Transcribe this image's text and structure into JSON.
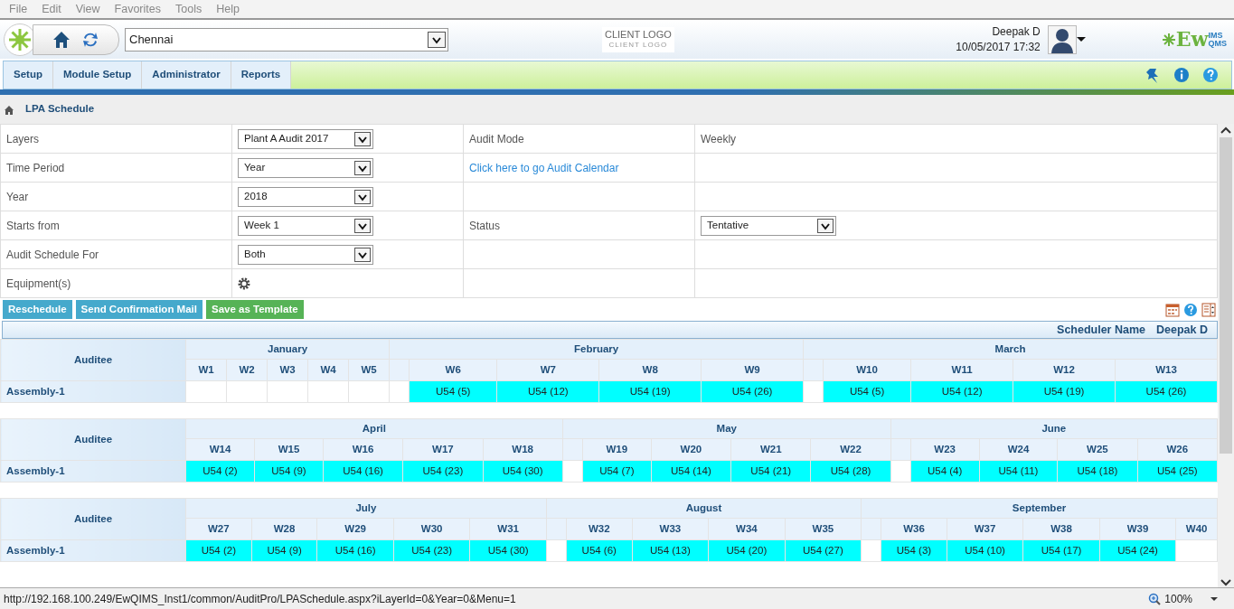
{
  "browser_menu": [
    "File",
    "Edit",
    "View",
    "Favorites",
    "Tools",
    "Help"
  ],
  "header": {
    "location": "Chennai",
    "client_logo": "CLIENT LOGO",
    "client_logo_tagline": "CLIENT LOGO",
    "user": "Deepak D",
    "datetime": "10/05/2017 17:32",
    "brand": {
      "main": "Ew",
      "sup": "IMS",
      "sub": "QMS"
    }
  },
  "nav": [
    "Setup",
    "Module Setup",
    "Administrator",
    "Reports"
  ],
  "breadcrumb": "LPA Schedule",
  "form": [
    {
      "cells": [
        {
          "kind": "label",
          "text": "Layers"
        },
        {
          "kind": "select",
          "value": "Plant A Audit 2017"
        },
        {
          "kind": "label",
          "text": "Audit Mode"
        },
        {
          "kind": "label",
          "text": "Weekly"
        }
      ]
    },
    {
      "cells": [
        {
          "kind": "label",
          "text": "Time Period"
        },
        {
          "kind": "select",
          "value": "Year"
        },
        {
          "kind": "link",
          "text": "Click here to go Audit Calendar"
        },
        {
          "kind": "empty"
        }
      ]
    },
    {
      "cells": [
        {
          "kind": "label",
          "text": "Year"
        },
        {
          "kind": "select",
          "value": "2018"
        },
        {
          "kind": "empty"
        },
        {
          "kind": "empty"
        }
      ]
    },
    {
      "cells": [
        {
          "kind": "label",
          "text": "Starts from"
        },
        {
          "kind": "select",
          "value": "Week 1"
        },
        {
          "kind": "label",
          "text": "Status"
        },
        {
          "kind": "select",
          "value": "Tentative"
        }
      ]
    },
    {
      "cells": [
        {
          "kind": "label",
          "text": "Audit Schedule For"
        },
        {
          "kind": "select",
          "value": "Both"
        },
        {
          "kind": "empty"
        },
        {
          "kind": "empty"
        }
      ]
    },
    {
      "cells": [
        {
          "kind": "label",
          "text": "Equipment(s)"
        },
        {
          "kind": "gear"
        },
        {
          "kind": "empty"
        },
        {
          "kind": "empty"
        }
      ]
    }
  ],
  "actions": [
    {
      "label": "Reschedule",
      "color": "#45a9cc"
    },
    {
      "label": "Send Confirmation Mail",
      "color": "#45a9cc"
    },
    {
      "label": "Save as Template",
      "color": "#56b356"
    }
  ],
  "scheduler": {
    "label": "Scheduler Name",
    "name": "Deepak D"
  },
  "schedule_blocks": [
    {
      "header": "Auditee",
      "auditee": "Assembly-1",
      "months": [
        {
          "name": "January",
          "weeks": [
            {
              "label": "W1"
            },
            {
              "label": "W2"
            },
            {
              "label": "W3"
            },
            {
              "label": "W4"
            },
            {
              "label": "W5"
            }
          ]
        },
        {
          "name": "February",
          "weeks": [
            {
              "label": "W6",
              "entry": "U54 (5)"
            },
            {
              "label": "W7",
              "entry": "U54 (12)"
            },
            {
              "label": "W8",
              "entry": "U54 (19)"
            },
            {
              "label": "W9",
              "entry": "U54 (26)"
            }
          ]
        },
        {
          "name": "March",
          "weeks": [
            {
              "label": "W10",
              "entry": "U54 (5)"
            },
            {
              "label": "W11",
              "entry": "U54 (12)"
            },
            {
              "label": "W12",
              "entry": "U54 (19)"
            },
            {
              "label": "W13",
              "entry": "U54 (26)"
            }
          ]
        }
      ]
    },
    {
      "header": "Auditee",
      "auditee": "Assembly-1",
      "months": [
        {
          "name": "April",
          "weeks": [
            {
              "label": "W14",
              "entry": "U54 (2)"
            },
            {
              "label": "W15",
              "entry": "U54 (9)"
            },
            {
              "label": "W16",
              "entry": "U54 (16)"
            },
            {
              "label": "W17",
              "entry": "U54 (23)"
            },
            {
              "label": "W18",
              "entry": "U54 (30)"
            }
          ]
        },
        {
          "name": "May",
          "weeks": [
            {
              "label": "W19",
              "entry": "U54 (7)"
            },
            {
              "label": "W20",
              "entry": "U54 (14)"
            },
            {
              "label": "W21",
              "entry": "U54 (21)"
            },
            {
              "label": "W22",
              "entry": "U54 (28)"
            }
          ]
        },
        {
          "name": "June",
          "weeks": [
            {
              "label": "W23",
              "entry": "U54 (4)"
            },
            {
              "label": "W24",
              "entry": "U54 (11)"
            },
            {
              "label": "W25",
              "entry": "U54 (18)"
            },
            {
              "label": "W26",
              "entry": "U54 (25)"
            }
          ]
        }
      ]
    },
    {
      "header": "Auditee",
      "auditee": "Assembly-1",
      "months": [
        {
          "name": "July",
          "weeks": [
            {
              "label": "W27",
              "entry": "U54 (2)"
            },
            {
              "label": "W28",
              "entry": "U54 (9)"
            },
            {
              "label": "W29",
              "entry": "U54 (16)"
            },
            {
              "label": "W30",
              "entry": "U54 (23)"
            },
            {
              "label": "W31",
              "entry": "U54 (30)"
            }
          ]
        },
        {
          "name": "August",
          "weeks": [
            {
              "label": "W32",
              "entry": "U54 (6)"
            },
            {
              "label": "W33",
              "entry": "U54 (13)"
            },
            {
              "label": "W34",
              "entry": "U54 (20)"
            },
            {
              "label": "W35",
              "entry": "U54 (27)"
            }
          ]
        },
        {
          "name": "September",
          "weeks": [
            {
              "label": "W36",
              "entry": "U54 (3)"
            },
            {
              "label": "W37",
              "entry": "U54 (10)"
            },
            {
              "label": "W38",
              "entry": "U54 (17)"
            },
            {
              "label": "W39",
              "entry": "U54 (24)"
            },
            {
              "label": "W40"
            }
          ]
        }
      ]
    }
  ],
  "status_bar": {
    "url": "http://192.168.100.249/EwQIMS_Inst1/common/AuditPro/LPASchedule.aspx?iLayerId=0&Year=0&Menu=1",
    "zoom": "100%"
  }
}
